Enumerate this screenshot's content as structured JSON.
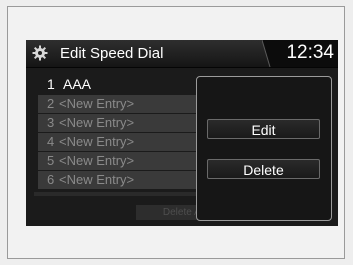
{
  "header": {
    "title": "Edit Speed Dial",
    "clock": "12:34",
    "icon": "gear-icon"
  },
  "entries": [
    {
      "num": "1",
      "label": "AAA"
    },
    {
      "num": "2",
      "label": "<New Entry>"
    },
    {
      "num": "3",
      "label": "<New Entry>"
    },
    {
      "num": "4",
      "label": "<New Entry>"
    },
    {
      "num": "5",
      "label": "<New Entry>"
    },
    {
      "num": "6",
      "label": "<New Entry>"
    }
  ],
  "delete_all": "Delete All",
  "popup": {
    "edit_label": "Edit",
    "delete_label": "Delete"
  },
  "colors": {
    "screen_bg": "#1b1b1b",
    "text": "#ffffff",
    "dim_text": "#8a8a8a"
  }
}
